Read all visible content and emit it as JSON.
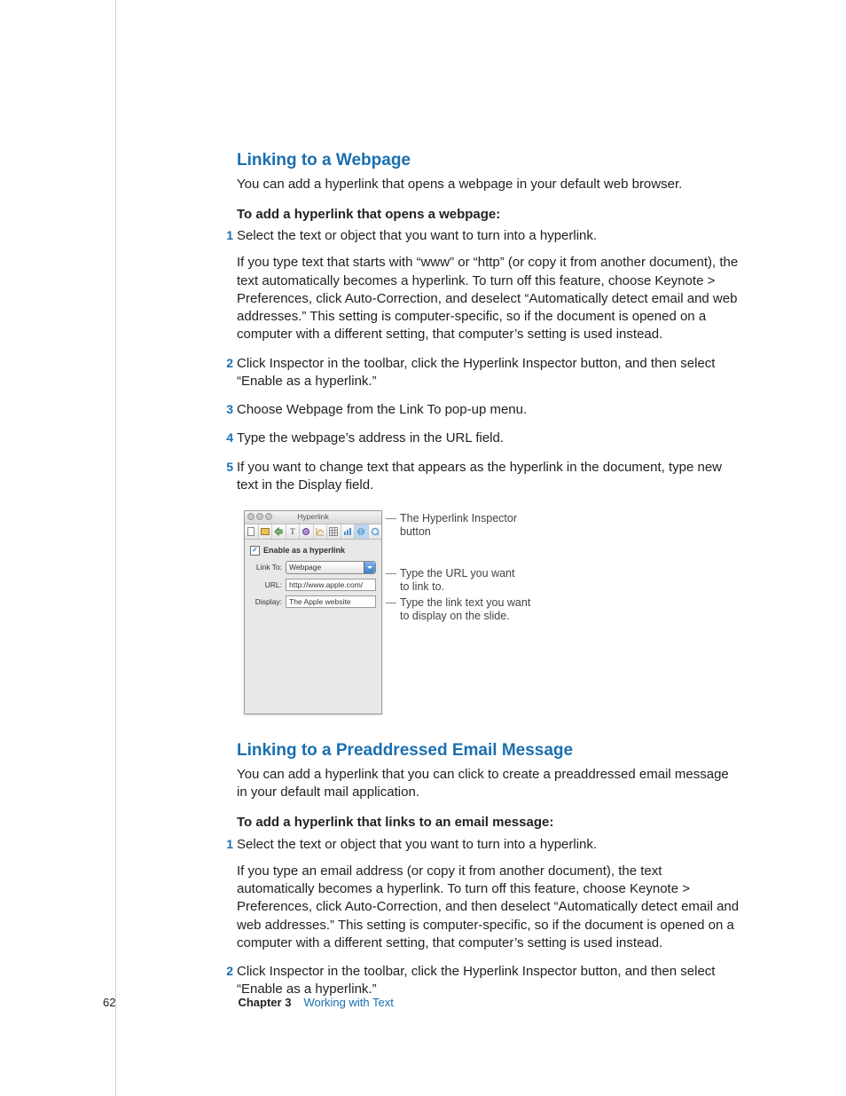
{
  "section1": {
    "heading": "Linking to a Webpage",
    "intro": "You can add a hyperlink that opens a webpage in your default web browser.",
    "lead": "To add a hyperlink that opens a webpage:",
    "steps": [
      {
        "num": "1",
        "paras": [
          "Select the text or object that you want to turn into a hyperlink.",
          "If you type text that starts with “www” or “http” (or copy it from another document), the text automatically becomes a hyperlink. To turn off this feature, choose Keynote > Preferences, click Auto-Correction, and deselect “Automatically detect email and web addresses.” This setting is computer-specific, so if the document is opened on a computer with a different setting, that computer’s setting is used instead."
        ]
      },
      {
        "num": "2",
        "paras": [
          "Click Inspector in the toolbar, click the Hyperlink Inspector button, and then select “Enable as a hyperlink.”"
        ]
      },
      {
        "num": "3",
        "paras": [
          "Choose Webpage from the Link To pop-up menu."
        ]
      },
      {
        "num": "4",
        "paras": [
          "Type the webpage’s address in the URL field."
        ]
      },
      {
        "num": "5",
        "paras": [
          "If you want to change text that appears as the hyperlink in the document, type new text in the Display field."
        ]
      }
    ]
  },
  "inspector": {
    "title": "Hyperlink",
    "checkbox_label": "Enable as a hyperlink",
    "link_to_label": "Link To:",
    "link_to_value": "Webpage",
    "url_label": "URL:",
    "url_value": "http://www.apple.com/",
    "display_label": "Display:",
    "display_value": "The Apple website",
    "checkmark": "✓"
  },
  "callouts": {
    "c1": "The Hyperlink Inspector button",
    "c2": "Type the URL you want to link to.",
    "c3": "Type the link text you want to display on the slide."
  },
  "section2": {
    "heading": "Linking to a Preaddressed Email Message",
    "intro": "You can add a hyperlink that you can click to create a preaddressed email message in your default mail application.",
    "lead": "To add a hyperlink that links to an email message:",
    "steps": [
      {
        "num": "1",
        "paras": [
          "Select the text or object that you want to turn into a hyperlink.",
          "If you type an email address (or copy it from another document), the text automatically becomes a hyperlink. To turn off this feature, choose Keynote > Preferences, click Auto-Correction, and then deselect “Automatically detect email and web addresses.” This setting is computer-specific, so if the document is opened on a computer with a different setting, that computer’s setting is used instead."
        ]
      },
      {
        "num": "2",
        "paras": [
          "Click Inspector in the toolbar, click the Hyperlink Inspector button, and then select “Enable as a hyperlink.”"
        ]
      }
    ]
  },
  "footer": {
    "page": "62",
    "chapter": "Chapter 3",
    "title": "Working with Text"
  }
}
